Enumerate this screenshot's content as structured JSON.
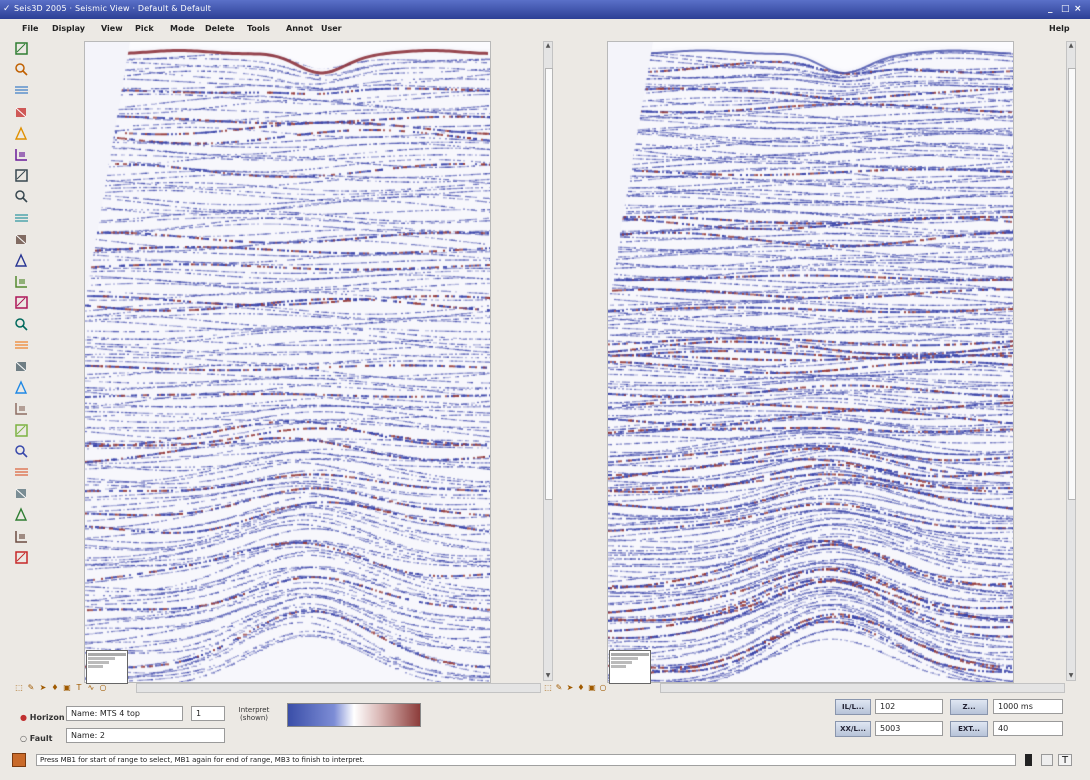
{
  "window": {
    "title": "Seis3D 2005 · Seismic View · Default & Default",
    "controls": [
      "_",
      "□",
      "×"
    ]
  },
  "menu": {
    "items": [
      "File",
      "Display",
      "View",
      "Pick",
      "Mode",
      "Delete",
      "Tools",
      "Annot",
      "User"
    ],
    "help": "Help"
  },
  "toolbar": {
    "tools": [
      "pointer-icon",
      "zoom-extent-icon",
      "horizontal-line-icon",
      "pick-horizon-icon",
      "pick-fault-icon",
      "edit-icon",
      "zoom-in-icon",
      "zoom-out-icon",
      "pan-icon",
      "bracket-icon",
      "trace-icon",
      "auto-track-icon",
      "snap-icon",
      "fill-icon",
      "color-icon",
      "grid-icon",
      "cross-icon",
      "box-icon",
      "list-icon",
      "wave-icon",
      "stack-icon",
      "column-icon",
      "split-icon",
      "ruler-icon",
      "flag-icon"
    ]
  },
  "bottom": {
    "horizon_label": "Horizon",
    "fault_label": "Fault",
    "horizon_value": "Name: MTS 4 top",
    "horizon_index": "1",
    "fault_value": "Name: 2",
    "interpret_label": "Interpret (shown)",
    "colorbar": {
      "low_color": "#3a4ea8",
      "mid_color": "#ffffff",
      "high_color": "#8c3c3a"
    },
    "il_button": "IL/L...",
    "il_value": "102",
    "xl_button": "XX/L...",
    "xl_value": "5003",
    "z_button": "Z...",
    "z_value": "1000 ms",
    "ext_button": "EXT...",
    "ext_value": "40"
  },
  "status": {
    "message": "Press MB1 for start of range to select, MB1 again for end of range, MB3 to finish to interpret."
  }
}
